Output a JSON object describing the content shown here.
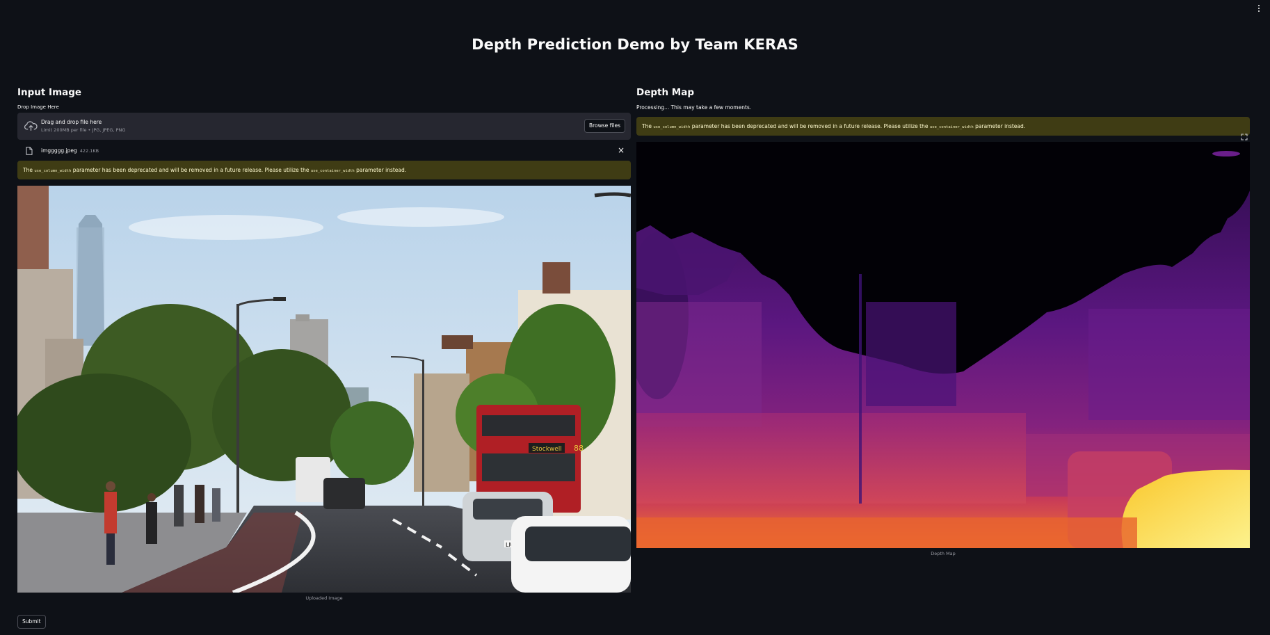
{
  "app": {
    "title": "Depth Prediction Demo by Team KERAS"
  },
  "left": {
    "heading": "Input Image",
    "uploader_label": "Drop Image Here",
    "dropzone_main": "Drag and drop file here",
    "dropzone_limit": "Limit 200MB per file • JPG, JPEG, PNG",
    "browse_label": "Browse files",
    "file_name": "imggggg.jpeg",
    "file_size": "422.1KB",
    "close_glyph": "×",
    "warning": {
      "prefix": "The",
      "code1": "use_column_width",
      "middle": "parameter has been deprecated and will be removed in a future release. Please utilize the",
      "code2": "use_container_width",
      "suffix": "parameter instead."
    },
    "image_caption": "Uploaded Image",
    "submit_label": "Submit"
  },
  "right": {
    "heading": "Depth Map",
    "processing": "Processing... This may take a few moments.",
    "warning": {
      "prefix": "The",
      "code1": "use_column_width",
      "middle": "parameter has been deprecated and will be removed in a future release. Please utilize the",
      "code2": "use_container_width",
      "suffix": "parameter instead."
    },
    "image_caption": "Depth Map"
  },
  "bus_sign": "Stockwell",
  "bus_number": "88",
  "plate": "LM58",
  "colors": {
    "background": "#0e1117",
    "dropzone": "#262730",
    "warning_bg": "#3f3c14",
    "warning_text": "#fffbd0"
  },
  "icons": [
    "menu-dots-icon",
    "cloud-upload-icon",
    "file-icon",
    "close-icon",
    "expand-icon"
  ]
}
